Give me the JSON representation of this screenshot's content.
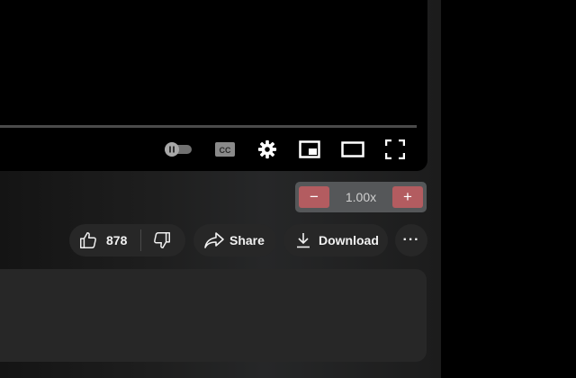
{
  "player": {
    "controls": {
      "autoplay": "autoplay-toggle-icon",
      "captions": "closed-captions-icon",
      "settings": "gear-icon",
      "miniplayer": "miniplayer-icon",
      "theater": "theater-mode-icon",
      "fullscreen": "fullscreen-icon"
    }
  },
  "speed_control": {
    "decrease_label": "−",
    "value": "1.00x",
    "increase_label": "+"
  },
  "actions": {
    "like_count": "878",
    "share_label": "Share",
    "download_label": "Download",
    "more_label": "···"
  },
  "colors": {
    "speed_button": "#b35c60",
    "pill_bg": "#272727",
    "page_bg": "#1e1e1e"
  }
}
